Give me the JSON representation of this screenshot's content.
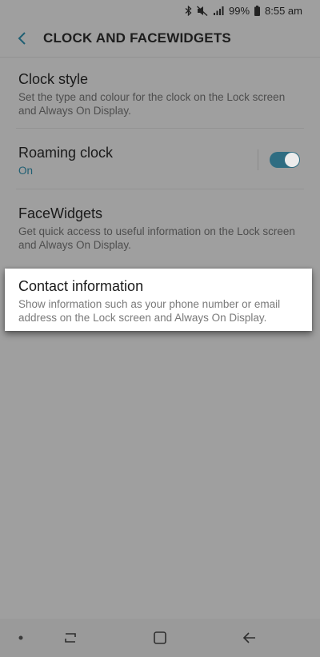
{
  "status_bar": {
    "battery_pct": "99%",
    "time": "8:55 am",
    "icons": [
      "bluetooth-icon",
      "mute-icon",
      "signal-icon",
      "battery-icon"
    ]
  },
  "header": {
    "title": "CLOCK AND FACEWIDGETS",
    "back_icon": "back-arrow-icon"
  },
  "items": [
    {
      "title": "Clock style",
      "description": "Set the type and colour for the clock on the Lock screen and Always On Display."
    },
    {
      "title": "Roaming clock",
      "status": "On",
      "toggle_on": true
    },
    {
      "title": "FaceWidgets",
      "description": "Get quick access to useful information on the Lock screen and Always On Display."
    },
    {
      "title": "Contact information",
      "description": "Show information such as your phone number or email address on the Lock screen and Always On Display.",
      "highlighted": true
    }
  ],
  "nav_bar": {
    "buttons": [
      "dot-indicator-icon",
      "recent-apps-icon",
      "home-icon",
      "back-icon"
    ]
  },
  "colors": {
    "accent": "#2f6d82",
    "dim_background": "#9f9f9f",
    "highlight_card": "#ffffff"
  }
}
